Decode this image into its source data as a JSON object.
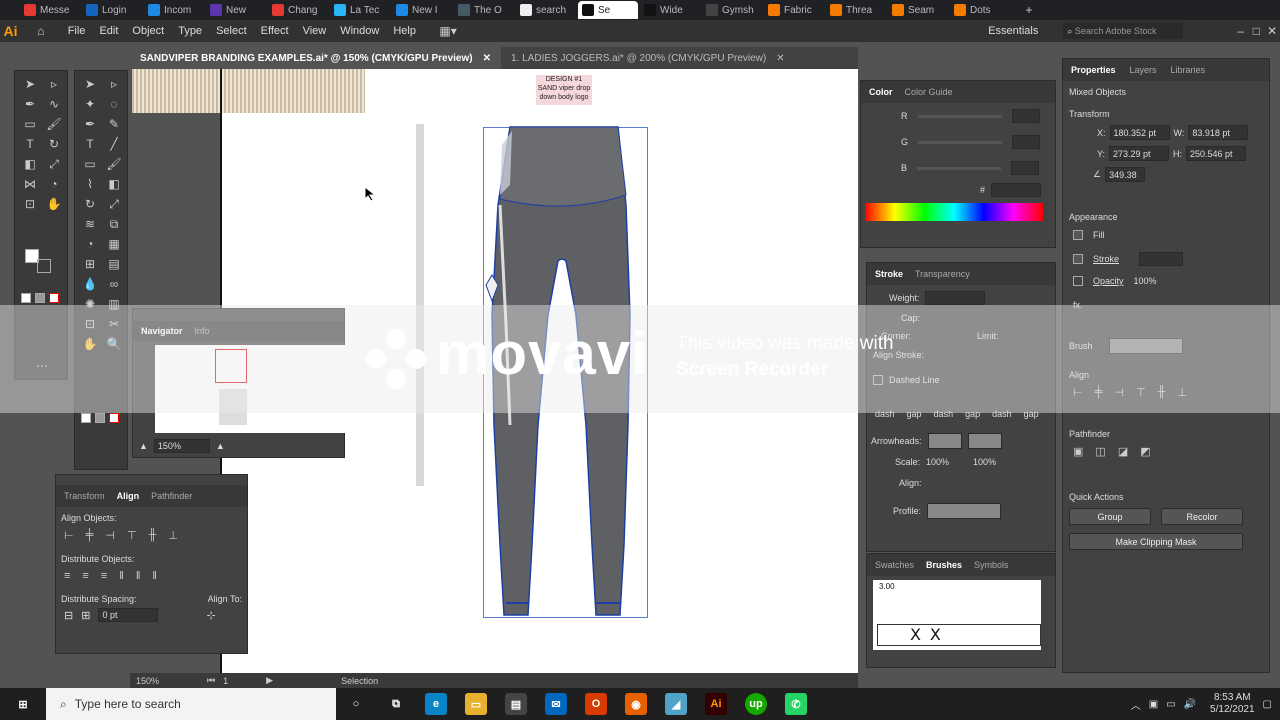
{
  "browser": {
    "tabs": [
      "Messe",
      "Login",
      "Incom",
      "New",
      "Chang",
      "La Tec",
      "New I",
      "The O",
      "search",
      "Se",
      "Wide",
      "Gymsh",
      "Fabric",
      "Threa",
      "Seam",
      "Dots"
    ]
  },
  "menu": {
    "items": [
      "File",
      "Edit",
      "Object",
      "Type",
      "Select",
      "Effect",
      "View",
      "Window",
      "Help"
    ],
    "workspace": "Essentials",
    "search_placeholder": "Search Adobe Stock"
  },
  "doc_tabs": [
    {
      "label": "SANDVIPER BRANDING EXAMPLES.ai* @ 150% (CMYK/GPU Preview)"
    },
    {
      "label": "1. LADIES JOGGERS.ai* @ 200% (CMYK/GPU Preview)"
    }
  ],
  "artboard": {
    "design_label": "DESIGN #1",
    "design_note1": "SAND viper drop",
    "design_note2": "down body logo"
  },
  "navigator": {
    "tabs": [
      "Navigator",
      "Info"
    ],
    "zoom": "150%"
  },
  "align_panel": {
    "tabs": [
      "Transform",
      "Align",
      "Pathfinder"
    ],
    "align_objects": "Align Objects:",
    "distribute_objects": "Distribute Objects:",
    "distribute_spacing": "Distribute Spacing:",
    "align_to": "Align To:",
    "spacing_value": "0 pt"
  },
  "color_panel": {
    "tabs": [
      "Color",
      "Color Guide"
    ],
    "r": "R",
    "g": "G",
    "b": "B",
    "hash": "#"
  },
  "stroke_panel": {
    "tabs": [
      "Stroke",
      "Transparency"
    ],
    "weight": "Weight:",
    "cap": "Cap:",
    "corner": "Corner:",
    "limit": "Limit:",
    "align_stroke": "Align Stroke:",
    "dashed_line": "Dashed Line",
    "dash": "dash",
    "gap": "gap",
    "arrowheads": "Arrowheads:",
    "scale": "Scale:",
    "scale1": "100%",
    "scale2": "100%",
    "align": "Align:",
    "profile": "Profile:"
  },
  "brushes_panel": {
    "tabs": [
      "Swatches",
      "Brushes",
      "Symbols"
    ],
    "size": "3.00"
  },
  "properties": {
    "tabs": [
      "Properties",
      "Layers",
      "Libraries"
    ],
    "selection_type": "Mixed Objects",
    "transform": "Transform",
    "x_label": "X:",
    "x": "180.352 pt",
    "w_label": "W:",
    "w": "83.918 pt",
    "y_label": "Y:",
    "y": "273.29 pt",
    "h_label": "H:",
    "h": "250.546 pt",
    "angle": "349.38",
    "appearance": "Appearance",
    "fill": "Fill",
    "stroke": "Stroke",
    "opacity": "Opacity",
    "opacity_value": "100%",
    "fx": "fx.",
    "brush": "Brush",
    "align": "Align",
    "pathfinder": "Pathfinder",
    "quick_actions": "Quick Actions",
    "group": "Group",
    "recolor": "Recolor",
    "make_clipping_mask": "Make Clipping Mask"
  },
  "status": {
    "zoom": "150%",
    "page": "1",
    "tool": "Selection"
  },
  "watermark": {
    "brand": "movavi",
    "line1": "This video was made with",
    "line2": "Screen Recorder"
  },
  "taskbar": {
    "search": "Type here to search",
    "time": "8:53 AM",
    "date": "5/12/2021"
  }
}
